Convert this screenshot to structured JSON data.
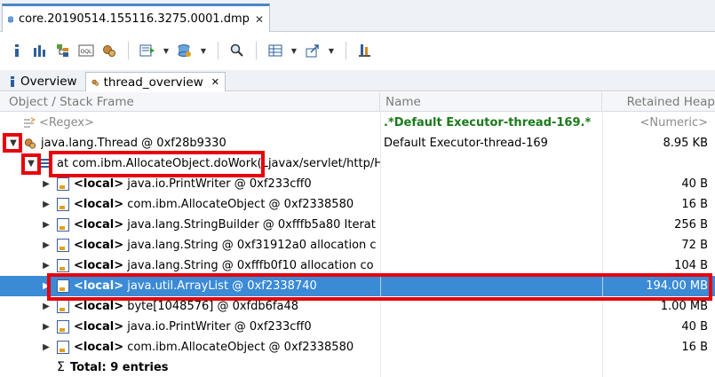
{
  "editor": {
    "tab_title": "core.20190514.155116.3275.0001.dmp",
    "close_glyph": "✕"
  },
  "toolbar": {
    "icons": [
      "info-icon",
      "histogram-icon",
      "dominator-tree-icon",
      "oql-icon",
      "thread-overview-icon",
      "query-browser-icon",
      "heap-dump-icon",
      "search-icon",
      "table-icon",
      "export-icon",
      "pin-icon"
    ]
  },
  "view_tabs": [
    {
      "label": "Overview"
    },
    {
      "label": "thread_overview",
      "close": "✕"
    }
  ],
  "table": {
    "headers": [
      "Object / Stack Frame",
      "Name",
      "Retained Heap"
    ],
    "filter_row": {
      "c1": "<Regex>",
      "c2": ".*Default Executor-thread-169.*",
      "c3": "<Numeric>"
    },
    "rows": [
      {
        "c1": "java.lang.Thread @ 0xf28b9330",
        "c2": "Default Executor-thread-169",
        "c3": "8.95 KB"
      },
      {
        "c1": "at com.ibm.AllocateObject.doWork(Ljavax/servlet/http/H",
        "c2": "",
        "c3": ""
      },
      {
        "kw": "<local>",
        "c1": " java.io.PrintWriter @ 0xf233cff0",
        "c2": "",
        "c3": "40 B"
      },
      {
        "kw": "<local>",
        "c1": " com.ibm.AllocateObject @ 0xf2338580",
        "c2": "",
        "c3": "16 B"
      },
      {
        "kw": "<local>",
        "c1": " java.lang.StringBuilder @ 0xfffb5a80  Iterat",
        "c2": "",
        "c3": "256 B"
      },
      {
        "kw": "<local>",
        "c1": " java.lang.String @ 0xf31912a0  allocation c",
        "c2": "",
        "c3": "72 B"
      },
      {
        "kw": "<local>",
        "c1": " java.lang.String @ 0xfffb0f10  allocation co",
        "c2": "",
        "c3": "104 B"
      },
      {
        "kw": "<local>",
        "c1": " java.util.ArrayList @ 0xf2338740",
        "c2": "",
        "c3": "194.00 MB"
      },
      {
        "kw": "<local>",
        "c1": " byte[1048576] @ 0xfdb6fa48",
        "c2": "",
        "c3": "1.00 MB"
      },
      {
        "kw": "<local>",
        "c1": " java.io.PrintWriter @ 0xf233cff0",
        "c2": "",
        "c3": "40 B"
      },
      {
        "kw": "<local>",
        "c1": " com.ibm.AllocateObject @ 0xf2338580",
        "c2": "",
        "c3": "16 B"
      }
    ],
    "total": "Total: 9 entries"
  },
  "colors": {
    "selection": "#3b8ad6",
    "annotation": "#e8000b",
    "accent": "#4e86c8"
  }
}
